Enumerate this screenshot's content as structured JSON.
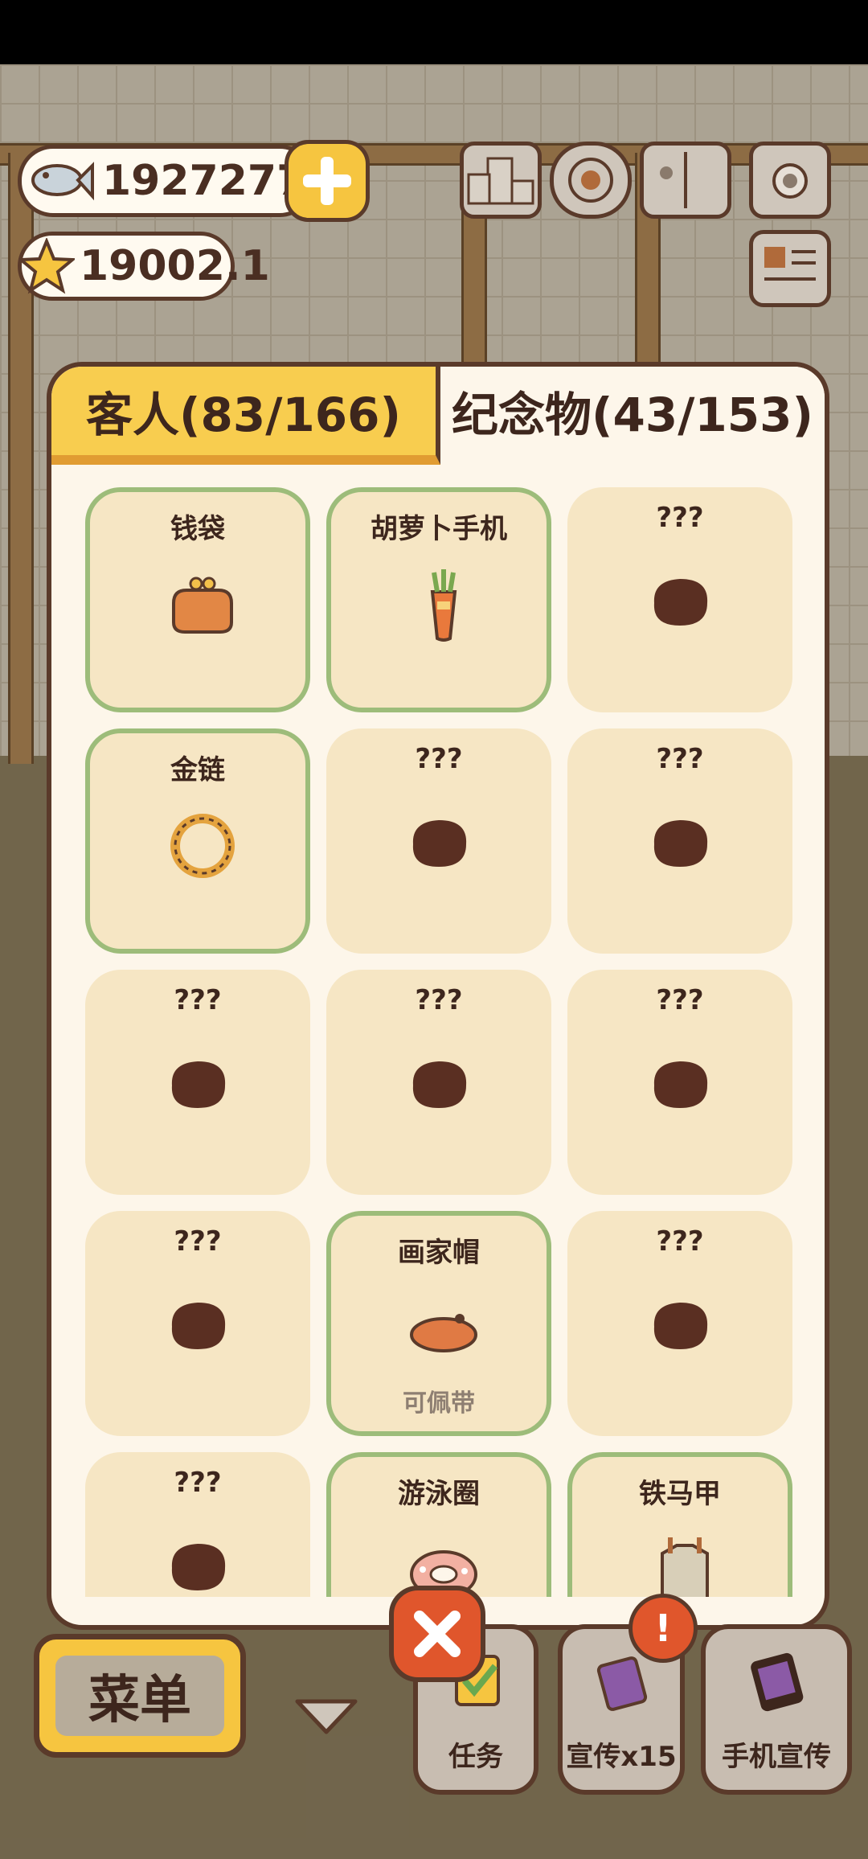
{
  "hud": {
    "fish_count": "1927277",
    "star_count": "19002.1",
    "icons": [
      "fish-icon",
      "plus-icon",
      "star-icon",
      "leaderboard-icon",
      "settings-gear-icon",
      "book-icon",
      "camera-icon",
      "newspaper-icon"
    ]
  },
  "tabs": {
    "customers": "客人(83/166)",
    "souvenirs": "纪念物(43/153)"
  },
  "items": [
    {
      "name": "钱袋",
      "owned": true,
      "icon": "purse-icon",
      "note": ""
    },
    {
      "name": "胡萝卜手机",
      "owned": true,
      "icon": "carrot-phone-icon",
      "note": ""
    },
    {
      "name": "???",
      "owned": false,
      "icon": "unknown-silhouette-icon",
      "note": ""
    },
    {
      "name": "金链",
      "owned": true,
      "icon": "gold-chain-icon",
      "note": ""
    },
    {
      "name": "???",
      "owned": false,
      "icon": "unknown-silhouette-icon",
      "note": ""
    },
    {
      "name": "???",
      "owned": false,
      "icon": "unknown-silhouette-icon",
      "note": ""
    },
    {
      "name": "???",
      "owned": false,
      "icon": "unknown-silhouette-icon",
      "note": ""
    },
    {
      "name": "???",
      "owned": false,
      "icon": "unknown-silhouette-icon",
      "note": ""
    },
    {
      "name": "???",
      "owned": false,
      "icon": "unknown-silhouette-icon",
      "note": ""
    },
    {
      "name": "???",
      "owned": false,
      "icon": "unknown-silhouette-icon",
      "note": ""
    },
    {
      "name": "画家帽",
      "owned": true,
      "icon": "beret-icon",
      "note": "可佩带"
    },
    {
      "name": "???",
      "owned": false,
      "icon": "unknown-silhouette-icon",
      "note": ""
    },
    {
      "name": "???",
      "owned": false,
      "icon": "unknown-silhouette-icon",
      "note": ""
    },
    {
      "name": "游泳圈",
      "owned": true,
      "icon": "swim-ring-icon",
      "note": ""
    },
    {
      "name": "铁马甲",
      "owned": true,
      "icon": "iron-vest-icon",
      "note": ""
    }
  ],
  "bottom": {
    "menu": "菜单",
    "tasks": "任务",
    "promo": "宣传x15",
    "phone_promo": "手机宣传",
    "badge": "!"
  },
  "colors": {
    "tab_active": "#f8cd4f",
    "card_bg": "#f6e6c4",
    "owned_border": "#9dbc7a",
    "outline": "#5a3a2a",
    "silhouette": "#5a2f22"
  }
}
